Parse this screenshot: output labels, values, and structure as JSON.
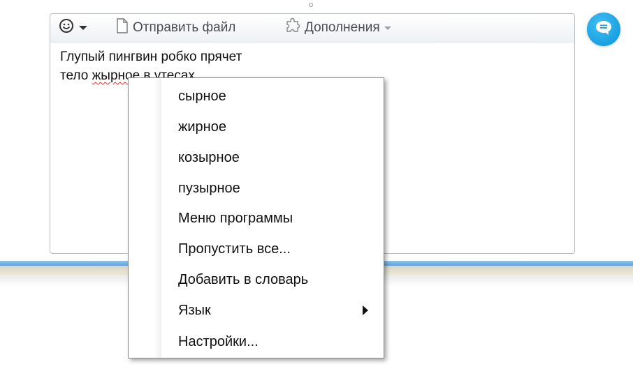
{
  "toolbar": {
    "send_file_label": "Отправить файл",
    "addons_label": "Дополнения"
  },
  "editor": {
    "line1": "Глупый пингвин робко прячет",
    "line2_prefix": "тело ",
    "misspelled_word": "жырное",
    "line2_suffix": " в утесах"
  },
  "context_menu": {
    "suggestions": [
      "сырное",
      "жирное",
      "козырное",
      "пузырное"
    ],
    "program_menu": "Меню программы",
    "skip_all": "Пропустить все...",
    "add_to_dictionary": "Добавить в словарь",
    "language": "Язык",
    "settings": "Настройки..."
  },
  "icons": {
    "emoji": "smiley-icon",
    "send_file": "document-icon",
    "addons": "puzzle-icon",
    "chat": "chat-bubble-icon"
  },
  "colors": {
    "accent": "#1aa3e8",
    "misspelling": "#e03030"
  }
}
